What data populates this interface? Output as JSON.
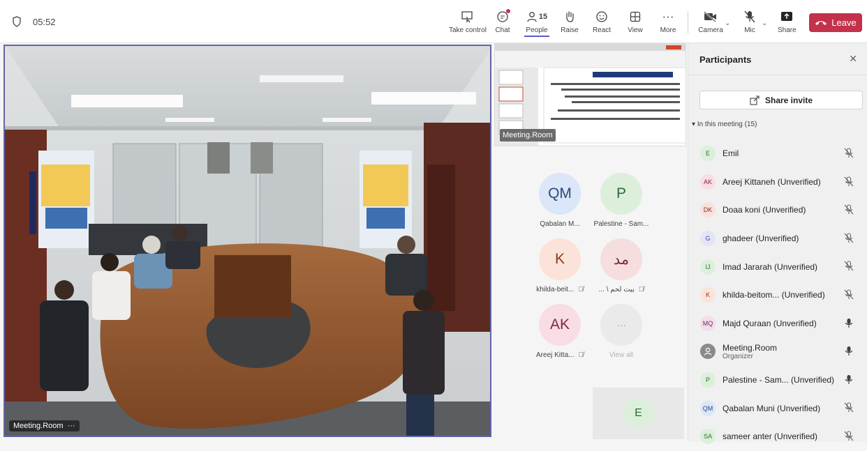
{
  "call": {
    "timer": "05:52"
  },
  "toolbar": {
    "take_control": "Take control",
    "chat": "Chat",
    "people": "People",
    "people_count": "15",
    "raise": "Raise",
    "react": "React",
    "view": "View",
    "more": "More",
    "camera": "Camera",
    "mic": "Mic",
    "share": "Share",
    "leave": "Leave"
  },
  "stage": {
    "room_label": "Meeting.Room",
    "room_dots": "···",
    "share_tooltip": "Meeting.Room"
  },
  "grid": {
    "tiles": [
      {
        "initials": "QM",
        "name": "Qabalan M...",
        "bg": "#dbe6f8",
        "fg": "#2b4a7a"
      },
      {
        "initials": "P",
        "name": "Palestine - Sam...",
        "bg": "#dcefdb",
        "fg": "#2f6b35"
      },
      {
        "initials": "K",
        "name": "khilda-beit...",
        "bg": "#fbe3d9",
        "fg": "#8a3a1a"
      },
      {
        "initials": "مد",
        "name": "... \\ بيت لحم",
        "bg": "#f6dede",
        "fg": "#7a2d2d"
      },
      {
        "initials": "AK",
        "name": "Areej Kitta...",
        "bg": "#f8dde4",
        "fg": "#7c2a3e"
      }
    ],
    "more_label": "···",
    "view_all": "View all",
    "small_tile_initials": "E"
  },
  "participants": {
    "title": "Participants",
    "share_invite": "Share invite",
    "section_label": "In this meeting (15)",
    "list": [
      {
        "initials": "E",
        "name": "Emil",
        "sub": "",
        "muted": true,
        "bg": "#dcefdb",
        "fg": "#2f6b35"
      },
      {
        "initials": "AK",
        "name": "Areej Kittaneh (Unverified)",
        "sub": "",
        "muted": true,
        "bg": "#f8dde4",
        "fg": "#7c2a3e"
      },
      {
        "initials": "DK",
        "name": "Doaa koni (Unverified)",
        "sub": "",
        "muted": true,
        "bg": "#fbe0dc",
        "fg": "#7e2f24"
      },
      {
        "initials": "G",
        "name": "ghadeer (Unverified)",
        "sub": "",
        "muted": true,
        "bg": "#e3e4f6",
        "fg": "#44479a"
      },
      {
        "initials": "IJ",
        "name": "Imad Jararah (Unverified)",
        "sub": "",
        "muted": true,
        "bg": "#dcefdb",
        "fg": "#2f6b35"
      },
      {
        "initials": "K",
        "name": "khilda-beitom...  (Unverified)",
        "sub": "",
        "muted": true,
        "bg": "#fbe3d9",
        "fg": "#8a3a1a"
      },
      {
        "initials": "MQ",
        "name": "Majd Quraan (Unverified)",
        "sub": "",
        "muted": false,
        "bg": "#f3dceb",
        "fg": "#6e2a5c"
      },
      {
        "initials": "",
        "name": "Meeting.Room",
        "sub": "Organizer",
        "muted": false,
        "bg": "#8a8a8a",
        "fg": "#ffffff"
      },
      {
        "initials": "P",
        "name": "Palestine - Sam... (Unverified)",
        "sub": "",
        "muted": false,
        "bg": "#dcefdb",
        "fg": "#2f6b35"
      },
      {
        "initials": "QM",
        "name": "Qabalan Muni (Unverified)",
        "sub": "",
        "muted": true,
        "bg": "#dbe6f8",
        "fg": "#2b4a7a"
      },
      {
        "initials": "SA",
        "name": "sameer anter (Unverified)",
        "sub": "",
        "muted": true,
        "bg": "#dcefdb",
        "fg": "#2f6b35"
      }
    ]
  },
  "colors": {
    "accent": "#6264a7",
    "leave": "#c4314b",
    "panel_bg": "#f0f0f0"
  },
  "icons": {
    "shield": "shield-icon",
    "take_control": "take-control-icon",
    "chat": "chat-icon",
    "people": "people-icon",
    "raise": "hand-icon",
    "react": "smiley-icon",
    "view": "grid-icon",
    "more": "ellipsis-icon",
    "camera": "camera-off-icon",
    "mic": "mic-off-icon",
    "share": "share-icon",
    "leave": "phone-icon",
    "close": "close-icon"
  }
}
